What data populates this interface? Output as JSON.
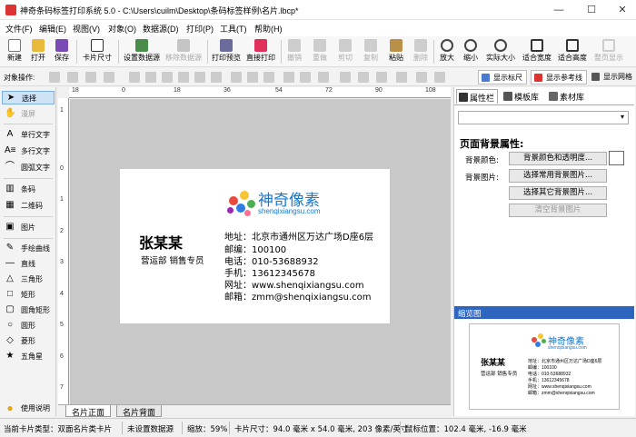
{
  "window": {
    "title": "神奇条码标签打印系统 5.0 - C:\\Users\\cuilm\\Desktop\\条码标签样例\\名片.lbcp*",
    "minimize": "—",
    "maximize": "☐",
    "close": "✕"
  },
  "menu": [
    "文件(F)",
    "编辑(E)",
    "视图(V)",
    "对象(O)",
    "数据源(D)",
    "打印(P)",
    "工具(T)",
    "帮助(H)"
  ],
  "toolbar": {
    "new": "新建",
    "open": "打开",
    "save": "保存",
    "card_size": "卡片尺寸",
    "set_datasource": "设置数据源",
    "remove_datasource": "移除数据源",
    "print_preview": "打印预览",
    "direct_print": "直接打印",
    "undo": "撤销",
    "redo": "重做",
    "cut": "剪切",
    "copy": "复制",
    "paste": "粘贴",
    "delete": "删除",
    "zoom_in": "放大",
    "zoom_out": "缩小",
    "actual_size": "实际大小",
    "fit_width": "适合宽度",
    "fit_height": "适合高度",
    "fit_page": "整页显示"
  },
  "objbar": {
    "label": "对象操作:",
    "show_ruler": "显示标尺",
    "show_guides": "显示参考线",
    "show_grid": "显示网格"
  },
  "tools": {
    "select": "选择",
    "pan": "漫屏",
    "single_text": "单行文字",
    "multi_text": "多行文字",
    "arc_text": "圆弧文字",
    "barcode": "条码",
    "qrcode": "二维码",
    "image": "图片",
    "freehand": "手绘曲线",
    "line": "直线",
    "triangle": "三角形",
    "rect": "矩形",
    "round_rect": "圆角矩形",
    "circle": "圆形",
    "diamond": "菱形",
    "star": "五角星",
    "help": "使用说明"
  },
  "ruler": {
    "h_labels": [
      "18",
      "0",
      "18",
      "36",
      "54",
      "72",
      "90",
      "108"
    ],
    "v_labels": [
      "1",
      "0",
      "1",
      "2",
      "3",
      "4",
      "5",
      "6",
      "7"
    ]
  },
  "card": {
    "name": "张某某",
    "role": "营运部 销售专员",
    "brand": "神奇像素",
    "domain": "shenqixiangsu.com",
    "info": [
      "地址：北京市通州区万达广场D座6层",
      "邮编：100100",
      "电话：010-53688932",
      "手机：13612345678",
      "网址：www.shenqixiangsu.com",
      "邮箱：zmm@shenqixiangsu.com"
    ],
    "logo_colors": [
      "#e84b3c",
      "#f7c433",
      "#4caf50",
      "#2f7de1",
      "#9c27b0",
      "#ff6f91"
    ]
  },
  "page_tabs": [
    "名片正面",
    "名片背面"
  ],
  "right_panel": {
    "tabs": [
      "属性栏",
      "模板库",
      "素材库"
    ],
    "title": "页面背景属性:",
    "bg_color_label": "背景颜色:",
    "bg_color_button": "背景颜色和透明度...",
    "bg_image_label": "背景图片:",
    "choose_common_bg": "选择常用背景图片...",
    "choose_other_bg": "选择其它背景图片...",
    "clear_bg": "清空背景图片",
    "preview_title": "缩览图"
  },
  "status": {
    "card_type": "当前卡片类型：双面名片类卡片",
    "datasource": "未设置数据源",
    "zoom": "缩放：59%",
    "card_size": "卡片尺寸：94.0 毫米 x 54.0 毫米, 203 像素/英寸",
    "mouse_pos": "鼠标位置：102.4 毫米, -16.9 毫米"
  }
}
